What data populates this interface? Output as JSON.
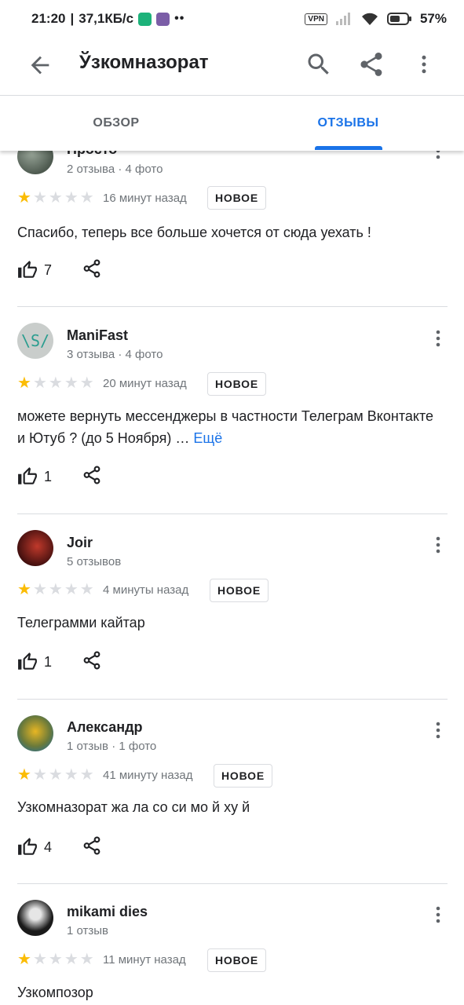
{
  "status_bar": {
    "time": "21:20",
    "speed": "37,1КБ/с",
    "vpn": "VPN",
    "battery": "57%"
  },
  "app_bar": {
    "title": "Ўзкомназорат",
    "icons": [
      "arrow-back-icon",
      "search-icon",
      "share-icon",
      "more-vert-icon"
    ]
  },
  "tabs": [
    {
      "label": "ОБЗОР",
      "selected": false
    },
    {
      "label": "ОТЗЫВЫ",
      "selected": true
    }
  ],
  "colors": {
    "accent": "#1a73e8",
    "star_filled": "#fbbc04",
    "star_empty": "#dadce0",
    "text_secondary": "#70757a",
    "divider": "#dadce0"
  },
  "reviews": [
    {
      "name": "Просто",
      "meta": "2 отзыва · 4 фото",
      "rating": 1,
      "time": "16 минут назад",
      "badge": "НОВОЕ",
      "text": "Спасибо, теперь все больше хочется от сюда уехать !",
      "likes": "7"
    },
    {
      "name": "ManiFast",
      "meta": "3 отзыва · 4 фото",
      "rating": 1,
      "time": "20 минут назад",
      "badge": "НОВОЕ",
      "text": "можете вернуть мессенджеры в частности Телеграм Вконтакте и Ютуб ? (до 5 Ноября) …",
      "more_label": "Ещё",
      "likes": "1"
    },
    {
      "name": "Joir",
      "meta": "5 отзывов",
      "rating": 1,
      "time": "4 минуты назад",
      "badge": "НОВОЕ",
      "text": "Телеграмми кайтар",
      "likes": "1"
    },
    {
      "name": "Александр",
      "meta": "1 отзыв · 1 фото",
      "rating": 1,
      "time": "41 минуту назад",
      "badge": "НОВОЕ",
      "text": "Узкомназорат жа ла со си мо й ху й",
      "likes": "4"
    },
    {
      "name": "mikami dies",
      "meta": "1 отзыв",
      "rating": 1,
      "time": "11 минут назад",
      "badge": "НОВОЕ",
      "text": "Узкомпозор"
    }
  ]
}
